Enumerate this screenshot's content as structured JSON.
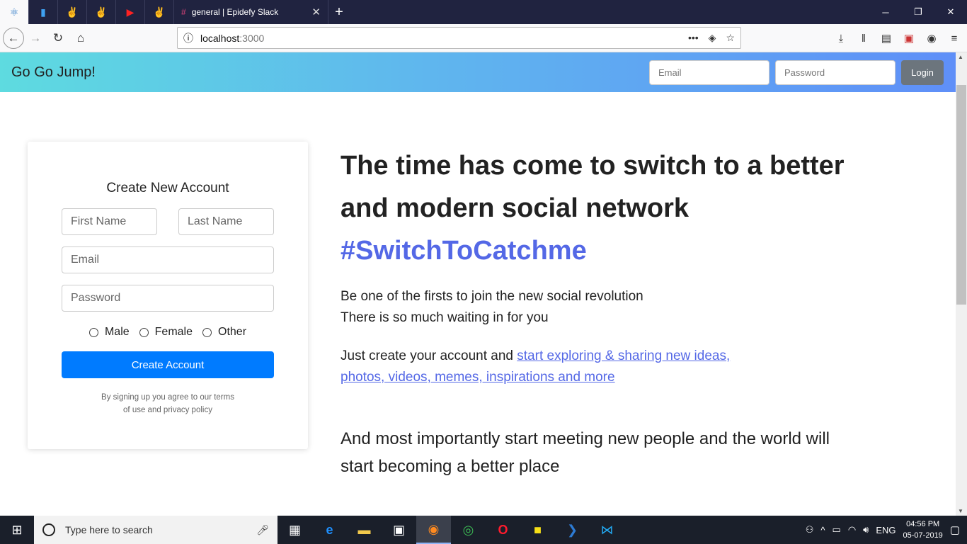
{
  "browser": {
    "tabs": [
      {
        "icon": "react-icon"
      },
      {
        "icon": "signal-bars-icon"
      },
      {
        "icon": "peace-hand-icon"
      },
      {
        "icon": "peace-hand-icon"
      },
      {
        "icon": "youtube-icon"
      },
      {
        "icon": "peace-hand-icon"
      }
    ],
    "active_tab": {
      "title": "general | Epidefy Slack",
      "icon": "slack-icon"
    },
    "url": {
      "host": "localhost",
      "port": ":3000"
    }
  },
  "header": {
    "brand": "Go Go Jump!",
    "email_placeholder": "Email",
    "password_placeholder": "Password",
    "login_label": "Login",
    "gradient": [
      "#5edbe0",
      "#5f8ff8"
    ]
  },
  "signup": {
    "title": "Create New Account",
    "first_name_placeholder": "First Name",
    "last_name_placeholder": "Last Name",
    "email_placeholder": "Email",
    "password_placeholder": "Password",
    "genders": [
      "Male",
      "Female",
      "Other"
    ],
    "submit_label": "Create Account",
    "terms_line1": "By signing up you agree to our terms",
    "terms_line2": "of use and privacy policy",
    "accent": "#007bff"
  },
  "hero": {
    "title_line1": "The time has come to switch to a better",
    "title_line2": "and modern social network",
    "hashtag": "#SwitchToCatchme",
    "p1_line1": "Be one of the firsts to join the new social revolution",
    "p1_line2": "There is so much waiting in for you",
    "p2_prefix": "Just create your account and ",
    "p2_link": "start exploring & sharing new ideas, photos, videos, memes, inspirations and more",
    "p3": "And most importantly start meeting new people and the world will start becoming a better place",
    "link_color": "#5468e6"
  },
  "taskbar": {
    "search_placeholder": "Type here to search",
    "apps": [
      "task-view-icon",
      "edge-icon",
      "file-explorer-icon",
      "store-icon",
      "firefox-icon",
      "chrome-icon",
      "opera-icon",
      "sticky-notes-icon",
      "powershell-icon",
      "vscode-icon"
    ],
    "language": "ENG",
    "time": "04:56 PM",
    "date": "05-07-2019"
  }
}
